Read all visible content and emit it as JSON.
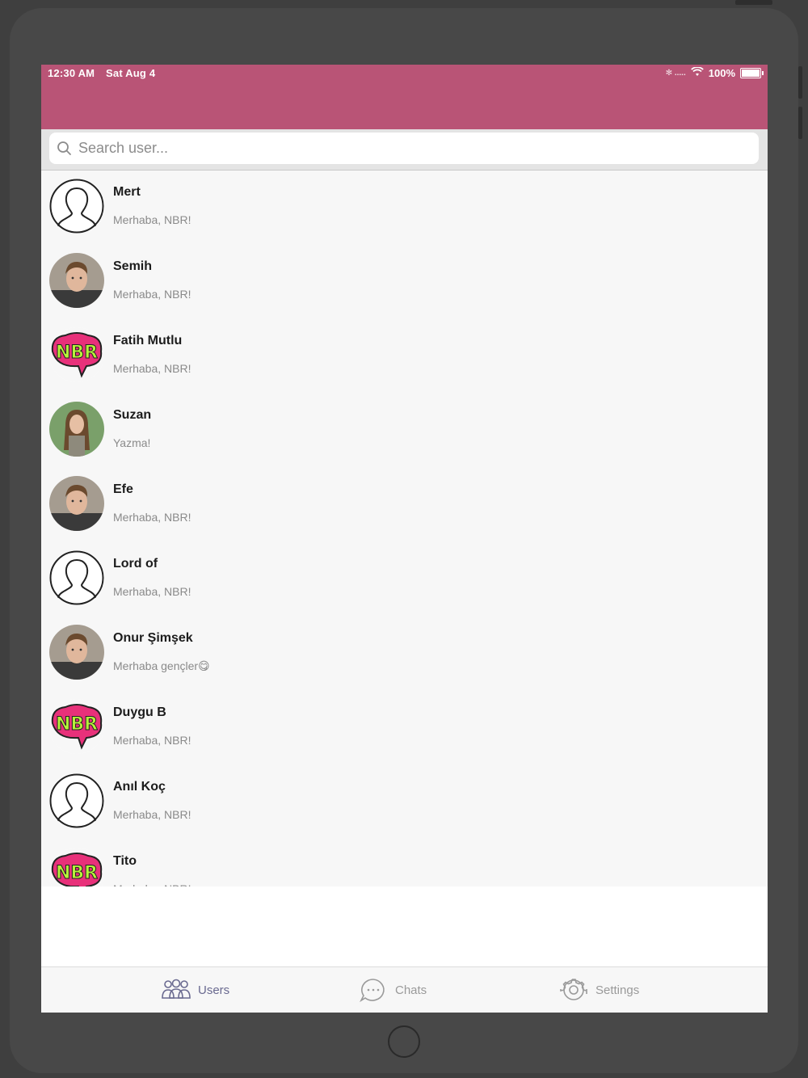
{
  "status_bar": {
    "time": "12:30 AM",
    "date": "Sat Aug 4",
    "wifi_icon": "wifi-icon",
    "battery": "100%"
  },
  "colors": {
    "header": "#b95476",
    "tab_active": "#6a6a90",
    "tab_inactive": "#9a9a9a"
  },
  "search": {
    "placeholder": "Search user..."
  },
  "users": [
    {
      "name": "Mert",
      "message": "Merhaba, NBR!",
      "avatar": "default-silhouette"
    },
    {
      "name": "Semih",
      "message": "Merhaba, NBR!",
      "avatar": "photo-man"
    },
    {
      "name": "Fatih Mutlu",
      "message": "Merhaba, NBR!",
      "avatar": "nbr-logo"
    },
    {
      "name": "Suzan",
      "message": "Yazma!",
      "avatar": "photo-woman"
    },
    {
      "name": "Efe",
      "message": "Merhaba, NBR!",
      "avatar": "photo-man"
    },
    {
      "name": "Lord of",
      "message": "Merhaba, NBR!",
      "avatar": "default-silhouette"
    },
    {
      "name": "Onur Şimşek",
      "message": "Merhaba gençler😋",
      "avatar": "photo-man"
    },
    {
      "name": "Duygu B",
      "message": "Merhaba, NBR!",
      "avatar": "nbr-logo"
    },
    {
      "name": "Anıl Koç",
      "message": "Merhaba, NBR!",
      "avatar": "default-silhouette"
    },
    {
      "name": "Tito",
      "message": "Merhaba, NBR!",
      "avatar": "nbr-logo"
    }
  ],
  "tabs": [
    {
      "label": "Users",
      "icon": "users-icon",
      "active": true
    },
    {
      "label": "Chats",
      "icon": "chat-bubble-icon",
      "active": false
    },
    {
      "label": "Settings",
      "icon": "gear-icon",
      "active": false
    }
  ]
}
